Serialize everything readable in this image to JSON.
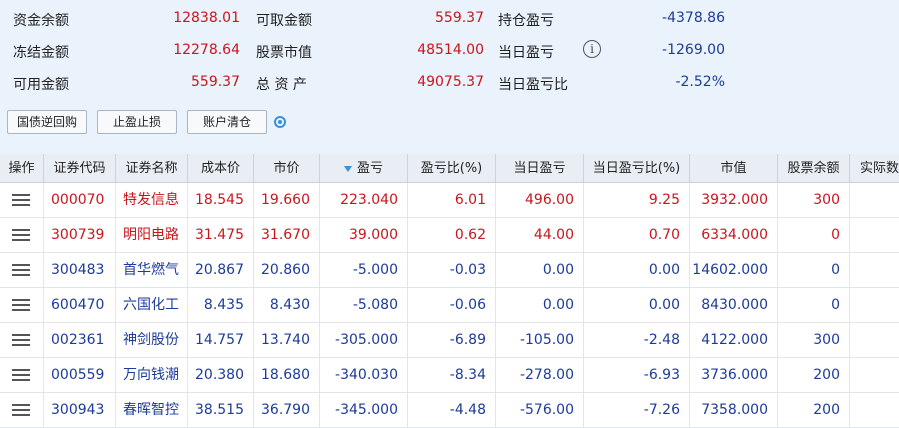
{
  "summary": {
    "fund_balance_label": "资金余额",
    "fund_balance": "12838.01",
    "withdrawable_label": "可取金额",
    "withdrawable": "559.37",
    "position_pl_label": "持仓盈亏",
    "position_pl": "-4378.86",
    "frozen_label": "冻结金额",
    "frozen": "12278.64",
    "stock_value_label": "股票市值",
    "stock_value": "48514.00",
    "today_pl_label": "当日盈亏",
    "today_pl": "-1269.00",
    "available_label": "可用金额",
    "available": "559.37",
    "total_assets_label": "总 资 产",
    "total_assets": "49075.37",
    "today_pl_ratio_label": "当日盈亏比",
    "today_pl_ratio": "-2.52%"
  },
  "buttons": {
    "repo": "国债逆回购",
    "stop": "止盈止损",
    "clear": "账户清仓"
  },
  "colors": {
    "red": "#c8161d",
    "blue": "#1d3b9a",
    "accent": "#3a8fd8"
  },
  "icons": {
    "info": "info-icon",
    "refresh": "refresh-icon",
    "sort": "sort-desc-icon",
    "row_menu": "menu-icon"
  },
  "table": {
    "headers": [
      "操作",
      "证券代码",
      "证券名称",
      "成本价",
      "市价",
      "盈亏",
      "盈亏比(%)",
      "当日盈亏",
      "当日盈亏比(%)",
      "市值",
      "股票余额",
      "实际数"
    ],
    "sort_column": "盈亏",
    "rows": [
      {
        "code": "000070",
        "name": "特发信息",
        "cost": "18.545",
        "price": "19.660",
        "pl": "223.040",
        "pl_ratio": "6.01",
        "day_pl": "496.00",
        "day_pl_ratio": "9.25",
        "mkt_value": "3932.000",
        "balance": "300",
        "color": "red"
      },
      {
        "code": "300739",
        "name": "明阳电路",
        "cost": "31.475",
        "price": "31.670",
        "pl": "39.000",
        "pl_ratio": "0.62",
        "day_pl": "44.00",
        "day_pl_ratio": "0.70",
        "mkt_value": "6334.000",
        "balance": "0",
        "color": "red"
      },
      {
        "code": "300483",
        "name": "首华燃气",
        "cost": "20.867",
        "price": "20.860",
        "pl": "-5.000",
        "pl_ratio": "-0.03",
        "day_pl": "0.00",
        "day_pl_ratio": "0.00",
        "mkt_value": "14602.000",
        "balance": "0",
        "color": "blue"
      },
      {
        "code": "600470",
        "name": "六国化工",
        "cost": "8.435",
        "price": "8.430",
        "pl": "-5.080",
        "pl_ratio": "-0.06",
        "day_pl": "0.00",
        "day_pl_ratio": "0.00",
        "mkt_value": "8430.000",
        "balance": "0",
        "color": "blue"
      },
      {
        "code": "002361",
        "name": "神剑股份",
        "cost": "14.757",
        "price": "13.740",
        "pl": "-305.000",
        "pl_ratio": "-6.89",
        "day_pl": "-105.00",
        "day_pl_ratio": "-2.48",
        "mkt_value": "4122.000",
        "balance": "300",
        "color": "blue"
      },
      {
        "code": "000559",
        "name": "万向钱潮",
        "cost": "20.380",
        "price": "18.680",
        "pl": "-340.030",
        "pl_ratio": "-8.34",
        "day_pl": "-278.00",
        "day_pl_ratio": "-6.93",
        "mkt_value": "3736.000",
        "balance": "200",
        "color": "blue"
      },
      {
        "code": "300943",
        "name": "春晖智控",
        "cost": "38.515",
        "price": "36.790",
        "pl": "-345.000",
        "pl_ratio": "-4.48",
        "day_pl": "-576.00",
        "day_pl_ratio": "-7.26",
        "mkt_value": "7358.000",
        "balance": "200",
        "color": "blue"
      }
    ]
  }
}
